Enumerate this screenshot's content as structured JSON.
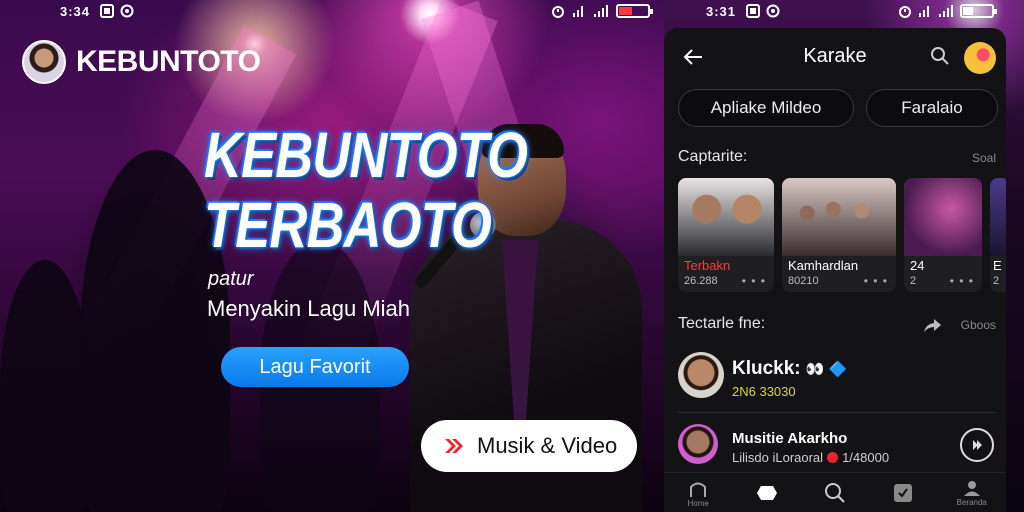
{
  "left": {
    "status": {
      "time": "3:34",
      "icons": [
        "notification-icon",
        "location-icon",
        "alarm-icon",
        "signal-icon",
        "battery-icon"
      ],
      "battery_level": 0.45,
      "battery_color": "#ff3b3b"
    },
    "brand": {
      "name": "KEBUNTOTO"
    },
    "top_icons": [
      "search-icon",
      "share-icon"
    ],
    "hero": {
      "title_line1": "KEBUNTOTO",
      "title_line2": "TERBAOTO",
      "small": "patur",
      "subtitle": "Menyakin Lagu Miah"
    },
    "buttons": {
      "favorite": "Lagu Favorit",
      "musik": "Musik & Video"
    },
    "colors": {
      "accent_blue": "#1e8fff",
      "button_red": "#e8262c"
    }
  },
  "right": {
    "status": {
      "time": "3:31",
      "battery_level": 0.35
    },
    "header": {
      "title": "Karake"
    },
    "tabs": [
      "Apliake Mildeo",
      "Faralaio"
    ],
    "section1": {
      "title": "Captarite:",
      "more": "Soal"
    },
    "cards": [
      {
        "label": "Terbakn",
        "label_color": "#ff3b3b",
        "sub": "26.288",
        "dots": "• • •"
      },
      {
        "label": "Kamhardlan",
        "label_color": "#ffffff",
        "sub": "80210",
        "dots": "• • •"
      },
      {
        "label": "24",
        "label_color": "#ffffff",
        "sub": "2",
        "dots": "• • •"
      },
      {
        "label": "E",
        "label_color": "#ffffff",
        "sub": "2",
        "dots": ""
      }
    ],
    "section2": {
      "title": "Tectarle fne:",
      "more": "Gboos"
    },
    "list": [
      {
        "title": "Kluckk:",
        "emoji": "👀 🔷",
        "sub": "2N6 33030",
        "sub_color": "#d8d832"
      },
      {
        "title": "Musitie Akarkho",
        "sub": "Lilisdo iLoraoral",
        "value": "1/48000",
        "sub_color": "#cfcfcf"
      }
    ],
    "nav": [
      {
        "icon": "home-icon",
        "label": "Home"
      },
      {
        "icon": "explore-icon",
        "label": ""
      },
      {
        "icon": "search-icon",
        "label": ""
      },
      {
        "icon": "library-icon",
        "label": ""
      },
      {
        "icon": "profile-icon",
        "label": "Beranda"
      }
    ]
  }
}
